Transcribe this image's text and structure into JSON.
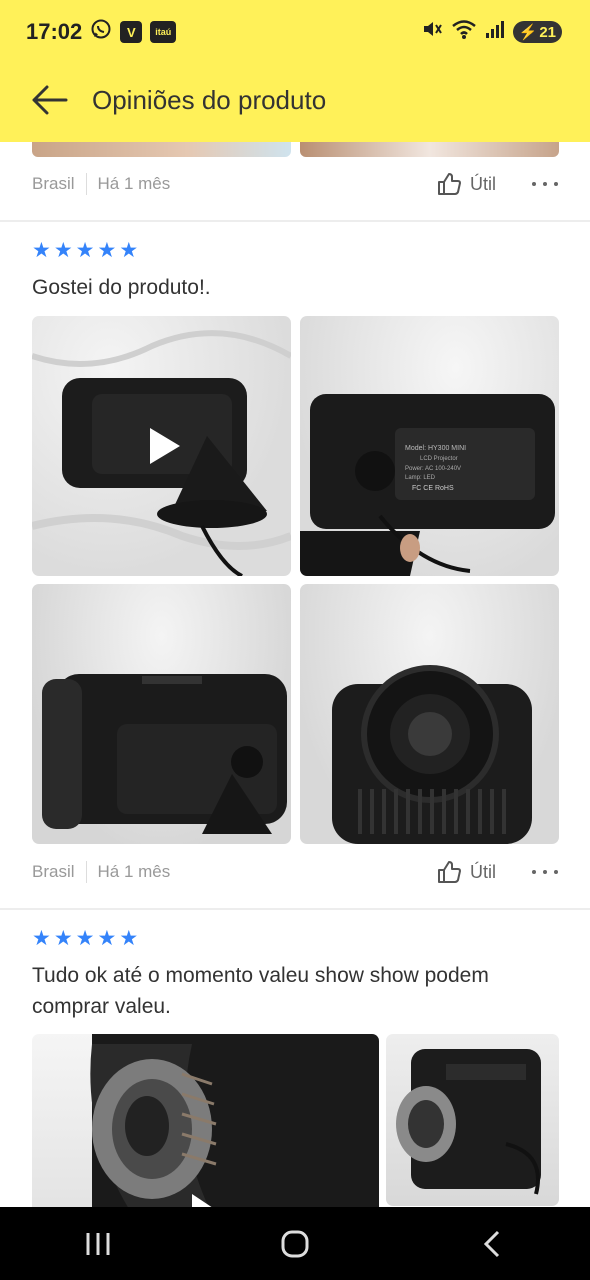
{
  "status_bar": {
    "time": "17:02",
    "apps": [
      "whatsapp-icon",
      "v-app-icon",
      "itau-icon"
    ],
    "itau_label": "itaú",
    "v_label": "V",
    "battery": "21"
  },
  "header": {
    "title": "Opiniões do produto",
    "back_icon": "arrow-left-icon",
    "background": "#fff159"
  },
  "reviews": [
    {
      "country": "Brasil",
      "date": "Há 1 mês",
      "useful_label": "Útil"
    },
    {
      "rating": 5,
      "text": "Gostei do produto!.",
      "country": "Brasil",
      "date": "Há 1 mês",
      "useful_label": "Útil",
      "photos": [
        {
          "kind": "video",
          "label": "LED Projector"
        },
        {
          "kind": "image",
          "label": "Projector label"
        },
        {
          "kind": "image",
          "label": "Projector side"
        },
        {
          "kind": "image",
          "label": "Projector lens"
        }
      ],
      "label_text": [
        "Model: HY300 MINI",
        "LCD Projector",
        "Power: AC 100-240V",
        "Lamp: LED",
        "FC CE RoHS"
      ]
    },
    {
      "rating": 5,
      "text": "Tudo ok até o momento valeu show show podem comprar valeu."
    }
  ],
  "accent": "#3483fa"
}
